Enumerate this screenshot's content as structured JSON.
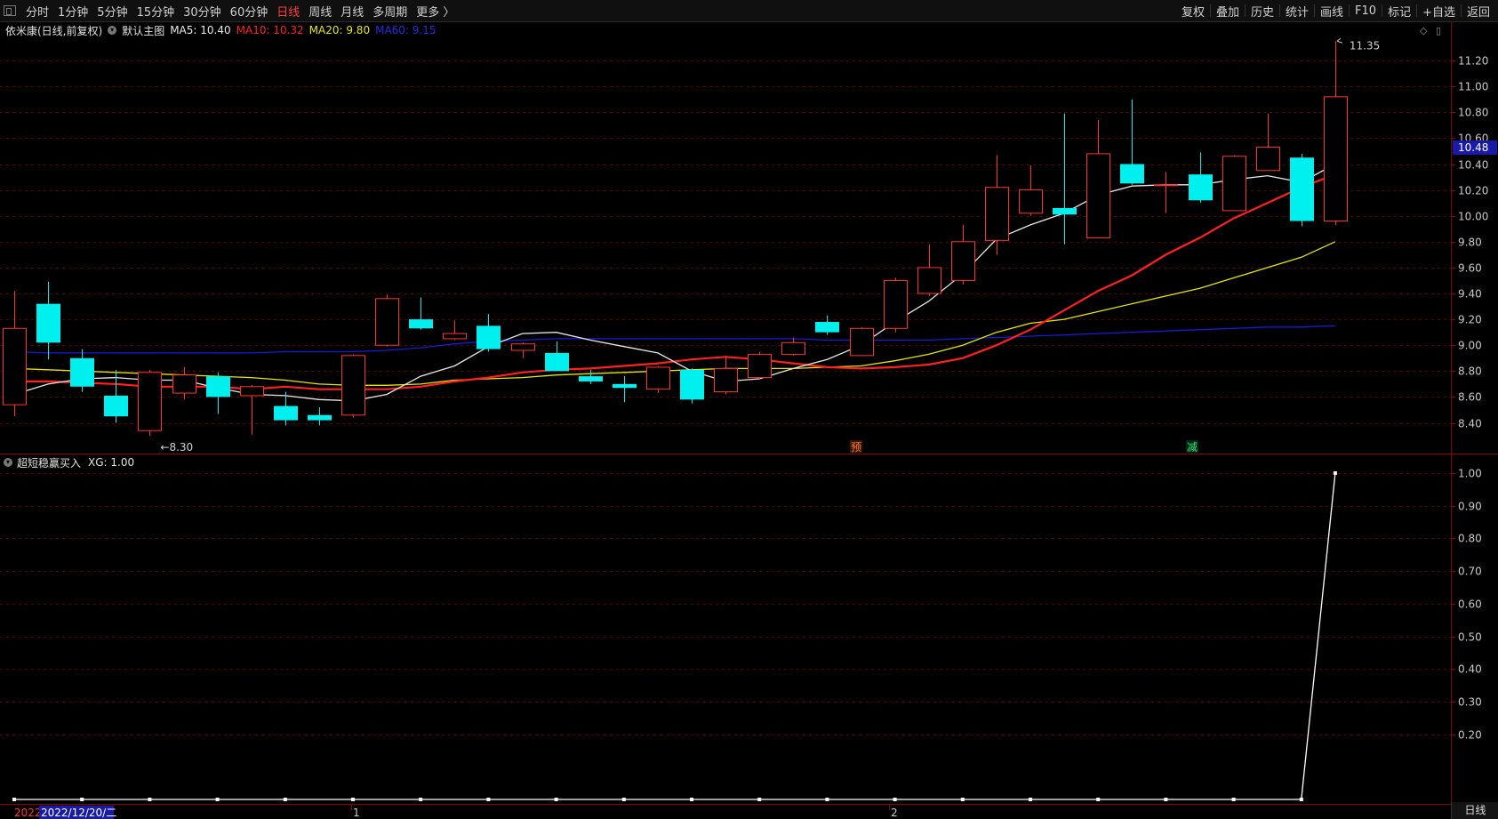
{
  "toolbar": {
    "periods": [
      "分时",
      "1分钟",
      "5分钟",
      "15分钟",
      "30分钟",
      "60分钟",
      "日线",
      "周线",
      "月线",
      "多周期",
      "更多 〉"
    ],
    "active_period": "日线",
    "actions": [
      "复权",
      "叠加",
      "历史",
      "统计",
      "画线",
      "F10",
      "标记",
      "+自选",
      "返回"
    ]
  },
  "main_info": {
    "stock_label": "依米康(日线,前复权)",
    "template_label": "默认主图",
    "ma5": "MA5: 10.40",
    "ma10": "MA10: 10.32",
    "ma20": "MA20: 9.80",
    "ma60": "MA60: 9.15"
  },
  "sub_info": {
    "indicator_label": "超短稳赢买入",
    "xg_value": "XG: 1.00"
  },
  "price_axis": {
    "ticks": [
      "11.20",
      "11.00",
      "10.80",
      "10.60",
      "10.40",
      "10.20",
      "10.00",
      "9.80",
      "9.60",
      "9.40",
      "9.20",
      "9.00",
      "8.80",
      "8.60",
      "8.40"
    ],
    "current_price_label": "10.48"
  },
  "sub_axis": {
    "ticks": [
      "1.00",
      "0.90",
      "0.80",
      "0.70",
      "0.60",
      "0.50",
      "0.40",
      "0.30",
      "0.20"
    ]
  },
  "annotations": {
    "high_label": "11.35",
    "low_label": "8.30",
    "mark_yu": "预",
    "mark_jian": "减"
  },
  "x_axis": {
    "year_prefix": "2022",
    "selected_date": "2022/12/20/二",
    "month_1": "1",
    "month_2": "2"
  },
  "period_indicator": "日线",
  "colors": {
    "up": "#ff3232",
    "down": "#00f0f0",
    "ma5": "#e8e8e8",
    "ma10": "#ff2020",
    "ma20": "#e6e600",
    "ma60": "#1a1ad8",
    "grid": "#5a0000",
    "axis_border": "#8b0000"
  },
  "chart_data": {
    "type": "candlestick",
    "ylim": [
      8.3,
      11.35
    ],
    "candles": [
      {
        "o": 8.54,
        "h": 9.42,
        "l": 8.45,
        "c": 9.13
      },
      {
        "o": 9.32,
        "h": 9.49,
        "l": 8.89,
        "c": 9.02
      },
      {
        "o": 8.9,
        "h": 8.97,
        "l": 8.64,
        "c": 8.68
      },
      {
        "o": 8.61,
        "h": 8.81,
        "l": 8.4,
        "c": 8.45
      },
      {
        "o": 8.34,
        "h": 8.81,
        "l": 8.3,
        "c": 8.79
      },
      {
        "o": 8.63,
        "h": 8.83,
        "l": 8.58,
        "c": 8.77
      },
      {
        "o": 8.76,
        "h": 8.79,
        "l": 8.47,
        "c": 8.6
      },
      {
        "o": 8.61,
        "h": 8.69,
        "l": 8.31,
        "c": 8.68
      },
      {
        "o": 8.53,
        "h": 8.64,
        "l": 8.38,
        "c": 8.42
      },
      {
        "o": 8.46,
        "h": 8.52,
        "l": 8.38,
        "c": 8.42
      },
      {
        "o": 8.46,
        "h": 8.93,
        "l": 8.44,
        "c": 8.92
      },
      {
        "o": 9.0,
        "h": 9.39,
        "l": 8.99,
        "c": 9.36
      },
      {
        "o": 9.2,
        "h": 9.37,
        "l": 9.12,
        "c": 9.13
      },
      {
        "o": 9.05,
        "h": 9.19,
        "l": 9.04,
        "c": 9.09
      },
      {
        "o": 9.15,
        "h": 9.24,
        "l": 8.95,
        "c": 8.97
      },
      {
        "o": 8.96,
        "h": 9.02,
        "l": 8.9,
        "c": 9.01
      },
      {
        "o": 8.94,
        "h": 9.03,
        "l": 8.81,
        "c": 8.8
      },
      {
        "o": 8.76,
        "h": 8.81,
        "l": 8.7,
        "c": 8.72
      },
      {
        "o": 8.7,
        "h": 8.76,
        "l": 8.56,
        "c": 8.67
      },
      {
        "o": 8.66,
        "h": 8.84,
        "l": 8.63,
        "c": 8.83
      },
      {
        "o": 8.81,
        "h": 8.82,
        "l": 8.55,
        "c": 8.58
      },
      {
        "o": 8.64,
        "h": 8.92,
        "l": 8.62,
        "c": 8.82
      },
      {
        "o": 8.75,
        "h": 8.95,
        "l": 8.74,
        "c": 8.93
      },
      {
        "o": 8.93,
        "h": 9.06,
        "l": 8.92,
        "c": 9.02
      },
      {
        "o": 9.18,
        "h": 9.23,
        "l": 9.08,
        "c": 9.1
      },
      {
        "o": 8.92,
        "h": 9.14,
        "l": 8.92,
        "c": 9.13
      },
      {
        "o": 9.13,
        "h": 9.52,
        "l": 9.1,
        "c": 9.5
      },
      {
        "o": 9.4,
        "h": 9.78,
        "l": 9.38,
        "c": 9.6
      },
      {
        "o": 9.5,
        "h": 9.93,
        "l": 9.47,
        "c": 9.8
      },
      {
        "o": 9.81,
        "h": 10.47,
        "l": 9.7,
        "c": 10.22
      },
      {
        "o": 10.02,
        "h": 10.39,
        "l": 10.0,
        "c": 10.2
      },
      {
        "o": 10.06,
        "h": 10.79,
        "l": 9.78,
        "c": 10.01
      },
      {
        "o": 9.83,
        "h": 10.74,
        "l": 9.83,
        "c": 10.48
      },
      {
        "o": 10.4,
        "h": 10.9,
        "l": 10.24,
        "c": 10.25
      },
      {
        "o": 10.24,
        "h": 10.34,
        "l": 10.02,
        "c": 10.24
      },
      {
        "o": 10.32,
        "h": 10.49,
        "l": 10.1,
        "c": 10.12
      },
      {
        "o": 10.04,
        "h": 10.47,
        "l": 10.04,
        "c": 10.46
      },
      {
        "o": 10.35,
        "h": 10.79,
        "l": 10.35,
        "c": 10.53
      },
      {
        "o": 10.45,
        "h": 10.48,
        "l": 9.92,
        "c": 9.96
      },
      {
        "o": 9.96,
        "h": 11.35,
        "l": 9.93,
        "c": 10.92
      }
    ],
    "ma5": [
      8.62,
      8.7,
      8.74,
      8.75,
      8.73,
      8.73,
      8.67,
      8.62,
      8.61,
      8.58,
      8.57,
      8.62,
      8.76,
      8.84,
      8.99,
      9.09,
      9.1,
      9.04,
      8.99,
      8.94,
      8.8,
      8.72,
      8.74,
      8.82,
      8.89,
      9.0,
      9.18,
      9.34,
      9.55,
      9.82,
      9.93,
      10.02,
      10.16,
      10.23,
      10.24,
      10.24,
      10.28,
      10.31,
      10.26,
      10.4
    ],
    "ma10": [
      8.72,
      8.72,
      8.71,
      8.7,
      8.68,
      8.68,
      8.68,
      8.66,
      8.68,
      8.66,
      8.66,
      8.66,
      8.68,
      8.72,
      8.75,
      8.79,
      8.81,
      8.82,
      8.84,
      8.86,
      8.89,
      8.91,
      8.89,
      8.86,
      8.83,
      8.82,
      8.83,
      8.85,
      8.9,
      9.0,
      9.12,
      9.27,
      9.42,
      9.54,
      9.7,
      9.83,
      9.98,
      10.1,
      10.22,
      10.32
    ],
    "ma20": [
      8.82,
      8.81,
      8.8,
      8.79,
      8.78,
      8.77,
      8.76,
      8.75,
      8.73,
      8.7,
      8.69,
      8.69,
      8.7,
      8.73,
      8.74,
      8.75,
      8.77,
      8.78,
      8.79,
      8.8,
      8.81,
      8.82,
      8.82,
      8.82,
      8.83,
      8.84,
      8.88,
      8.93,
      9.0,
      9.1,
      9.17,
      9.2,
      9.26,
      9.32,
      9.38,
      9.44,
      9.52,
      9.6,
      9.68,
      9.8
    ],
    "ma60": [
      8.95,
      8.94,
      8.94,
      8.94,
      8.94,
      8.94,
      8.94,
      8.94,
      8.95,
      8.95,
      8.95,
      8.96,
      8.98,
      9.01,
      9.03,
      9.04,
      9.05,
      9.05,
      9.05,
      9.05,
      9.05,
      9.05,
      9.05,
      9.05,
      9.04,
      9.04,
      9.04,
      9.04,
      9.05,
      9.06,
      9.07,
      9.08,
      9.09,
      9.1,
      9.11,
      9.12,
      9.13,
      9.14,
      9.14,
      9.15
    ],
    "xg": [
      0,
      0,
      0,
      0,
      0,
      0,
      0,
      0,
      0,
      0,
      0,
      0,
      0,
      0,
      0,
      0,
      0,
      0,
      0,
      0,
      0,
      0,
      0,
      0,
      0,
      0,
      0,
      0,
      0,
      0,
      0,
      0,
      0,
      0,
      0,
      0,
      0,
      0,
      0,
      1
    ],
    "sub_ylim": [
      0,
      1
    ]
  }
}
